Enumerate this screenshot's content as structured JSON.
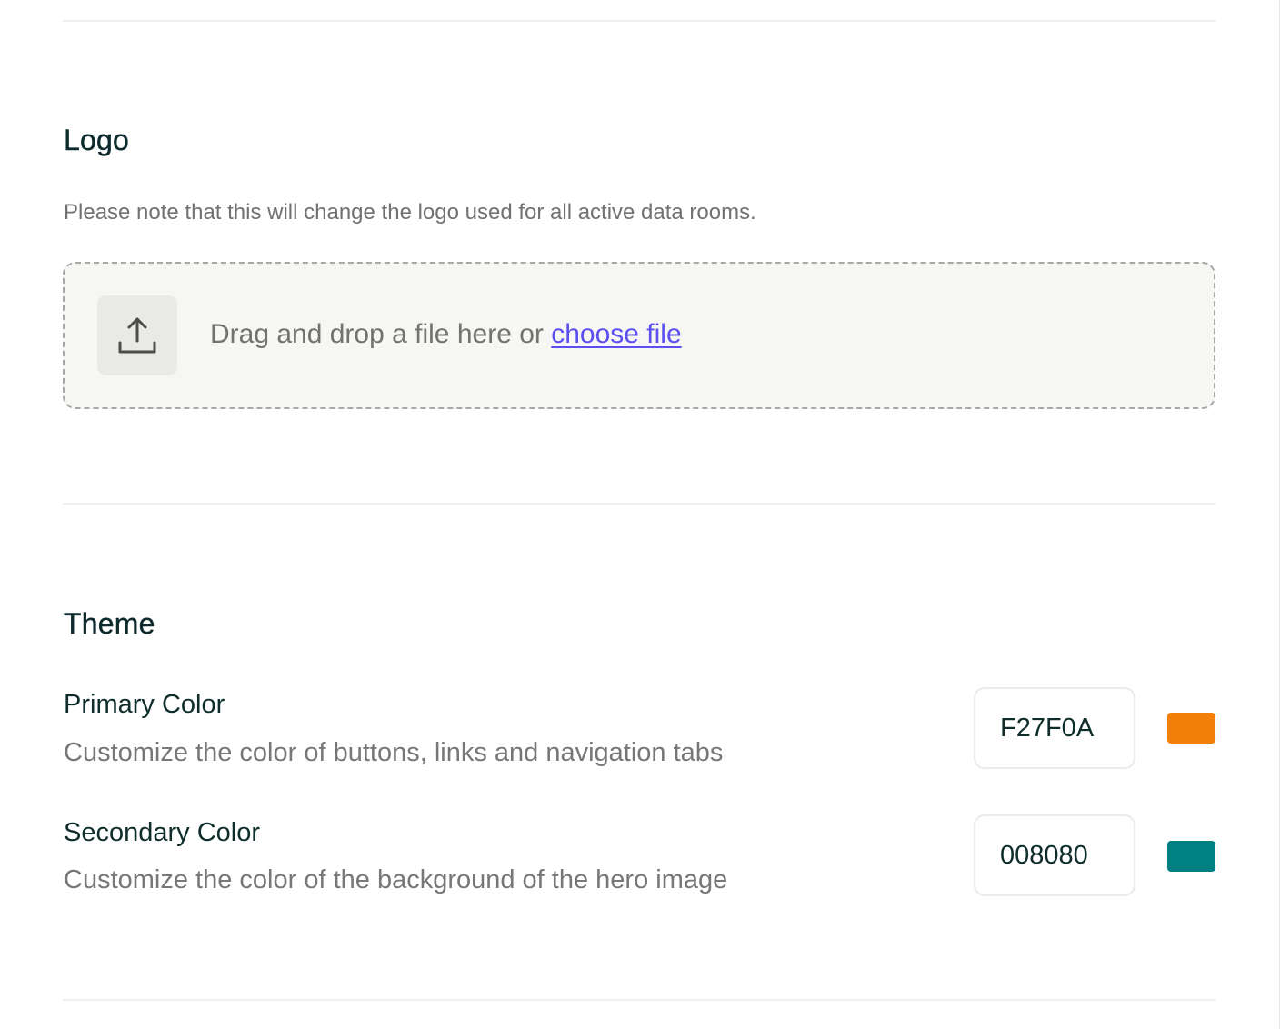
{
  "logo": {
    "title": "Logo",
    "note": "Please note that this will change the logo used for all active data rooms.",
    "dropzone": {
      "text": "Drag and drop a file here or ",
      "link": "choose file",
      "icon": "upload-icon"
    }
  },
  "theme": {
    "title": "Theme",
    "primary": {
      "label": "Primary Color",
      "description": "Customize the color of buttons, links and navigation tabs",
      "value": "F27F0A",
      "swatch_color": "#F27F0A"
    },
    "secondary": {
      "label": "Secondary Color",
      "description": "Customize the color of the background of the hero image",
      "value": "008080",
      "swatch_color": "#008080"
    }
  },
  "colors": {
    "link": "#5b4ff0",
    "heading": "#0d2a2c",
    "muted_text": "#6f726f"
  }
}
